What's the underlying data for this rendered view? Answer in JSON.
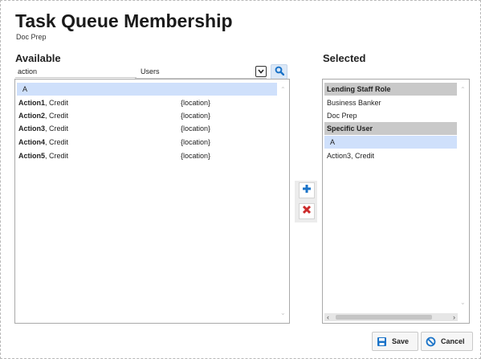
{
  "header": {
    "title": "Task Queue Membership",
    "subtitle": "Doc Prep"
  },
  "available": {
    "label": "Available",
    "search": {
      "value": "action",
      "placeholder": ""
    },
    "type_select": {
      "value": "Users"
    },
    "items": [
      {
        "bold": "A",
        "rest": "",
        "location": ""
      },
      {
        "bold": "Action1",
        "rest": ", Credit",
        "location": "{location}"
      },
      {
        "bold": "Action2",
        "rest": ", Credit",
        "location": "{location}"
      },
      {
        "bold": "Action3",
        "rest": ", Credit",
        "location": "{location}"
      },
      {
        "bold": "Action4",
        "rest": ", Credit",
        "location": "{location}"
      },
      {
        "bold": "Action5",
        "rest": ", Credit",
        "location": "{location}"
      }
    ]
  },
  "selected": {
    "label": "Selected",
    "items": [
      {
        "text": "Lending Staff Role",
        "kind": "group"
      },
      {
        "text": "Business Banker",
        "kind": "item"
      },
      {
        "text": "Doc Prep",
        "kind": "item"
      },
      {
        "text": "Specific User",
        "kind": "group"
      },
      {
        "text": "A",
        "kind": "selected"
      },
      {
        "text": "Action3, Credit",
        "kind": "item"
      }
    ]
  },
  "actions": {
    "save_label": "Save",
    "cancel_label": "Cancel"
  },
  "icons": {
    "search": "search-icon",
    "add": "plus-icon",
    "remove": "x-icon",
    "save": "floppy-disk-icon",
    "cancel": "no-entry-icon"
  },
  "colors": {
    "accent": "#1a73c8",
    "highlight": "#cfe0fb",
    "group_header": "#c9c9c9",
    "remove": "#cc2a2a"
  }
}
